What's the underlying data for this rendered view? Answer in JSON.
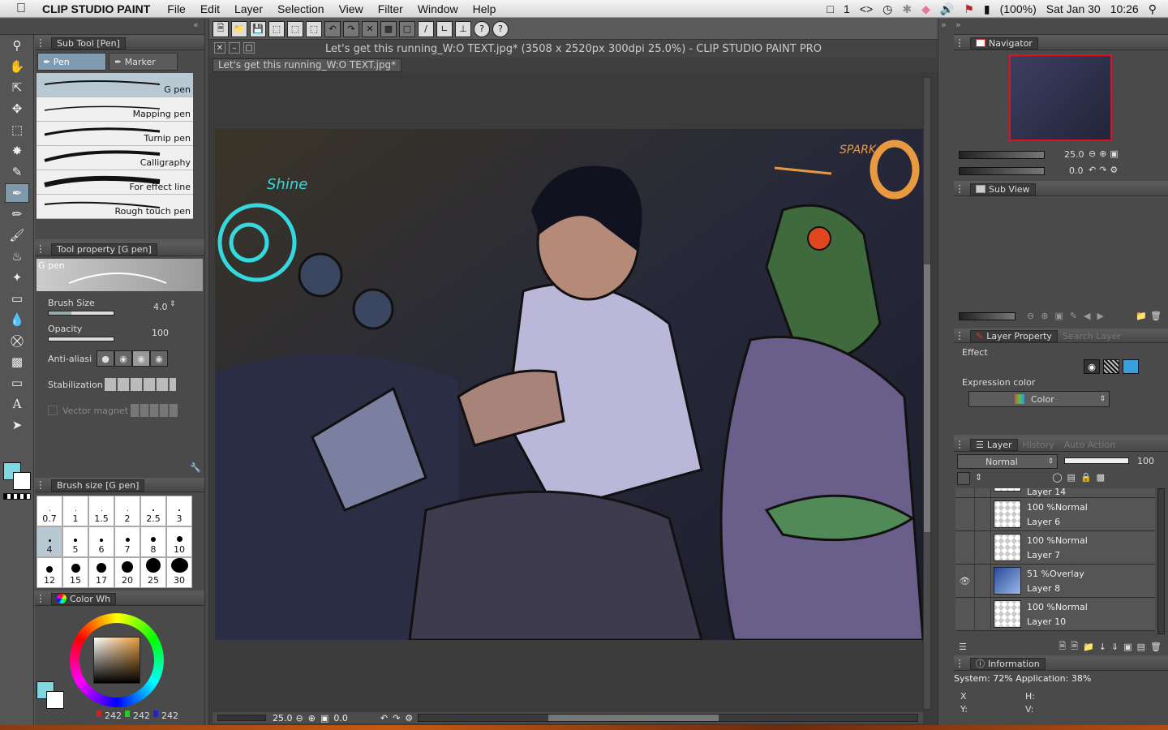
{
  "menubar": {
    "app_name": "CLIP STUDIO PAINT",
    "items": [
      "File",
      "Edit",
      "Layer",
      "Selection",
      "View",
      "Filter",
      "Window",
      "Help"
    ],
    "status_num": "1",
    "battery": "(100%)",
    "date": "Sat Jan 30",
    "time": "10:26"
  },
  "subtool": {
    "title": "Sub Tool [Pen]",
    "tabs": [
      "Pen",
      "Marker"
    ],
    "pens": [
      "G pen",
      "Mapping pen",
      "Turnip pen",
      "Calligraphy",
      "For effect line",
      "Rough touch pen"
    ]
  },
  "toolprop": {
    "title": "Tool property [G pen]",
    "preview_label": "G pen",
    "brush_size_label": "Brush Size",
    "brush_size_value": "4.0",
    "opacity_label": "Opacity",
    "opacity_value": "100",
    "antialias_label": "Anti-aliasi",
    "stabilization_label": "Stabilization",
    "vector_label": "Vector magnet"
  },
  "brushsize": {
    "title": "Brush size [G pen]",
    "sizes": [
      "0.7",
      "1",
      "1.5",
      "2",
      "2.5",
      "3",
      "4",
      "5",
      "6",
      "7",
      "8",
      "10",
      "12",
      "15",
      "17",
      "20",
      "25",
      "30"
    ]
  },
  "colorwheel": {
    "title": "Color Wh",
    "r": "242",
    "g": "242",
    "b": "242"
  },
  "document": {
    "window_title": "Let's get this running_W:O TEXT.jpg* (3508 x 2520px 300dpi 25.0%)  - CLIP STUDIO PAINT PRO",
    "tab": "Let's get this running_W:O TEXT.jpg*",
    "zoom": "25.0",
    "angle": "0.0",
    "art_text_shine": "Shine",
    "art_text_spark": "SPARK"
  },
  "navigator": {
    "title": "Navigator",
    "zoom": "25.0",
    "angle": "0.0"
  },
  "subview": {
    "title": "Sub View"
  },
  "layerprop": {
    "tabs": [
      "Layer Property",
      "Search Layer"
    ],
    "effect_label": "Effect",
    "expression_label": "Expression color",
    "expression_value": "Color"
  },
  "layers": {
    "tabs": [
      "Layer",
      "History",
      "Auto Action"
    ],
    "blend_mode": "Normal",
    "opacity": "100",
    "rows": [
      {
        "mode": "",
        "name": "Layer 14"
      },
      {
        "mode": "100 %Normal",
        "name": "Layer 6"
      },
      {
        "mode": "100 %Normal",
        "name": "Layer 7"
      },
      {
        "mode": "51 %Overlay",
        "name": "Layer 8"
      },
      {
        "mode": "100 %Normal",
        "name": "Layer 10"
      }
    ]
  },
  "info": {
    "title": "Information",
    "system": "System: 72% Application: 38%",
    "x": "X",
    "y": "Y:",
    "h": "H:",
    "v": "V:"
  },
  "colors": {
    "main_color": "#7fd8e0",
    "accent": "#7e9bb0"
  }
}
